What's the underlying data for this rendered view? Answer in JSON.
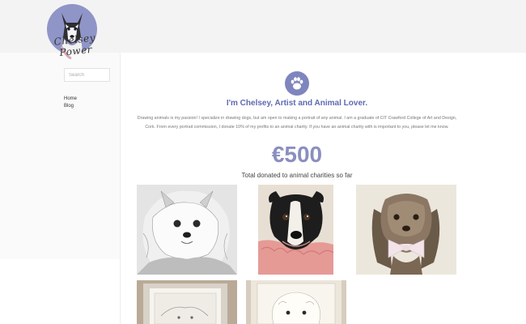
{
  "site": {
    "logo_text": "Chelsey Power",
    "colors": {
      "accent": "#5f69b0",
      "donation": "#8a8fbf",
      "paw_bg": "#7f85bd",
      "header_band": "#f3f3f3"
    }
  },
  "sidebar": {
    "search_placeholder": "Search",
    "items": [
      {
        "label": "Home"
      },
      {
        "label": "Blog"
      }
    ]
  },
  "main": {
    "icon": "paw-icon",
    "heading": "I'm Chelsey, Artist and Animal Lover.",
    "intro": "Drawing animals is my passion! I specialize in drawing dogs, but am open to making a portrait of any animal. I am a graduate of CIT Crawford College of Art and Design, Cork. From every portrait commission, I donate 10% of my profits to an animal charity. If you have an animal charity with is important to you, please let me know.",
    "donation_amount": "€500",
    "donation_caption": "Total donated to animal charities so far"
  }
}
